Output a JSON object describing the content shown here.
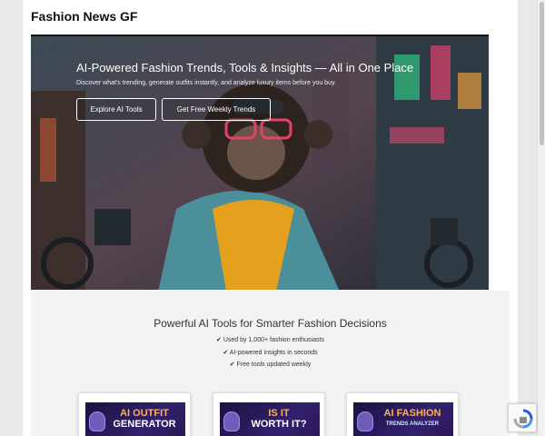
{
  "site": {
    "title": "Fashion News GF"
  },
  "hero": {
    "title": "AI-Powered Fashion Trends, Tools & Insights — All in One Place",
    "subtitle": "Discover what's trending, generate outfits instantly, and analyze luxury items before you buy.",
    "buttons": [
      {
        "label": "Explore AI Tools"
      },
      {
        "label": "Get Free Weekly Trends"
      }
    ]
  },
  "tools_section": {
    "heading": "Powerful AI Tools for Smarter Fashion Decisions",
    "checks": [
      "✔ Used by 1,000+ fashion enthusiasts",
      "✔ AI-powered insights in seconds",
      "✔ Free tools updated weekly"
    ],
    "cards": [
      {
        "line1": "AI OUTFIT",
        "line2": "GENERATOR",
        "icon": "robot-face-icon"
      },
      {
        "line1": "IS IT",
        "line2": "WORTH IT?",
        "icon": "robot-face-icon"
      },
      {
        "line1": "AI FASHION",
        "line2": "TRENDS ANALYZER",
        "icon": "robot-face-icon"
      }
    ]
  },
  "colors": {
    "card_title": "#ffb347",
    "card_bg": "#1b1240",
    "hero_text": "#ffffff"
  }
}
